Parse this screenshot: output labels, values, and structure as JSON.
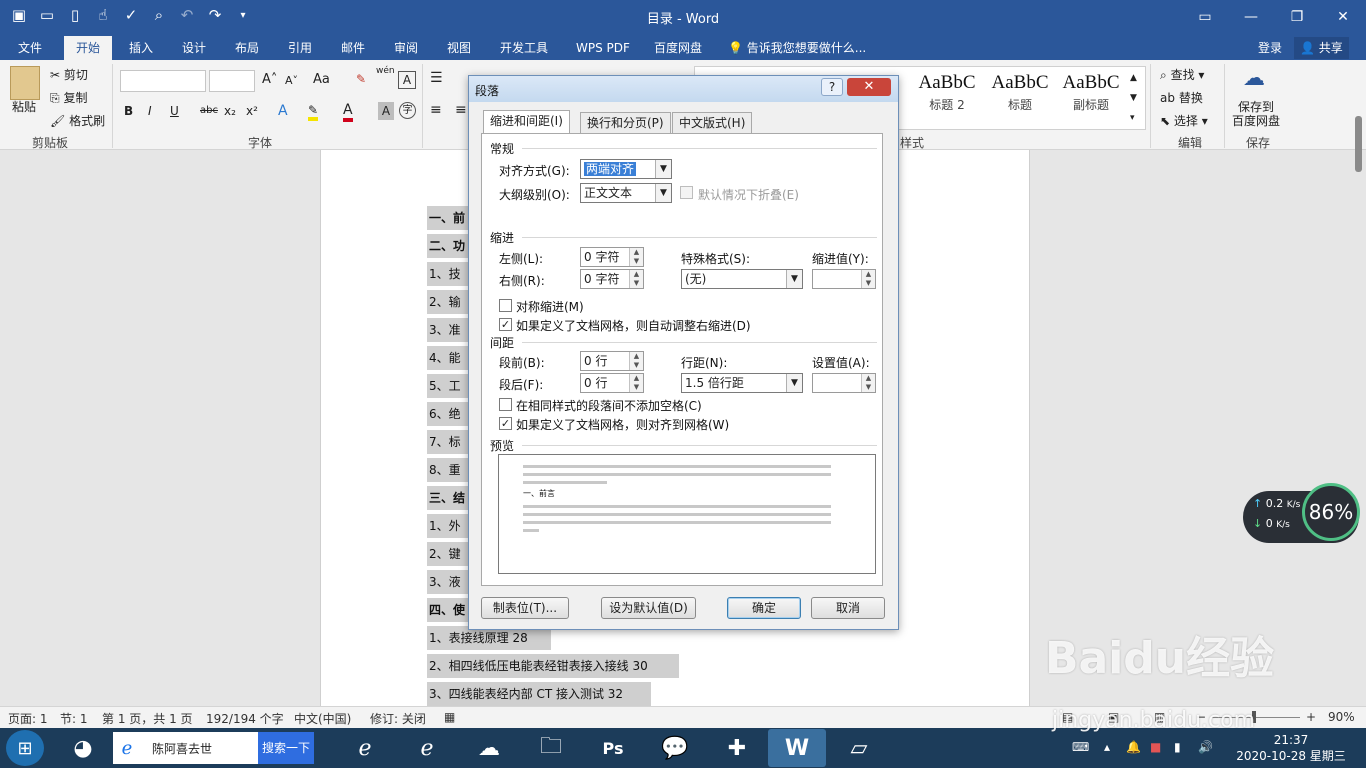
{
  "window": {
    "title": "目录 - Word"
  },
  "tabs": [
    "文件",
    "开始",
    "插入",
    "设计",
    "布局",
    "引用",
    "邮件",
    "审阅",
    "视图",
    "开发工具",
    "WPS PDF",
    "百度网盘"
  ],
  "tell_me": "告诉我您想要做什么...",
  "account": {
    "login": "登录",
    "share": "共享"
  },
  "ribbon": {
    "clipboard": {
      "paste": "粘贴",
      "cut": "剪切",
      "copy": "复制",
      "format_painter": "格式刷",
      "label": "剪贴板"
    },
    "font": {
      "label": "字体",
      "bold": "B",
      "italic": "I",
      "underline": "U",
      "strike": "abc",
      "sub": "x₂",
      "sup": "x²",
      "case": "Aa",
      "wen": "wén"
    },
    "styles": {
      "items": [
        {
          "sample": "AaBbC",
          "name": "标题 2"
        },
        {
          "sample": "AaBbC",
          "name": "标题"
        },
        {
          "sample": "AaBbC",
          "name": "副标题"
        }
      ],
      "label": "样式"
    },
    "editing": {
      "find": "查找",
      "replace": "替换",
      "select": "选择",
      "label": "编辑"
    },
    "save": {
      "line1": "保存到",
      "line2": "百度网盘",
      "label": "保存"
    }
  },
  "document": {
    "lines": [
      {
        "text": "一、前",
        "bold": true
      },
      {
        "text": "二、功",
        "bold": true
      },
      {
        "text": "1、技术",
        "bold": false
      },
      {
        "text": "2、输入",
        "bold": false
      },
      {
        "text": "3、准确",
        "bold": false
      },
      {
        "text": "4、能耗",
        "bold": false
      },
      {
        "text": "5、工作",
        "bold": false
      },
      {
        "text": "6、绝缘",
        "bold": false
      },
      {
        "text": "7、标准",
        "bold": false
      },
      {
        "text": "8、重量",
        "bold": false
      },
      {
        "text": "三、结",
        "bold": true
      },
      {
        "text": "1、外形",
        "bold": false
      },
      {
        "text": "2、键盘",
        "bold": false
      },
      {
        "text": "3、液晶",
        "bold": false
      },
      {
        "text": "四、使",
        "bold": true
      },
      {
        "text": "1、表接线原理    28",
        "bold": false
      },
      {
        "text": "2、相四线低压电能表经钳表接入接线    30",
        "bold": false
      },
      {
        "text": "3、四线能表经内部 CT 接入测试    32",
        "bold": false
      }
    ]
  },
  "dialog": {
    "title": "段落",
    "help": "?",
    "tabs": [
      "缩进和间距(I)",
      "换行和分页(P)",
      "中文版式(H)"
    ],
    "general": {
      "heading": "常规",
      "alignment_label": "对齐方式(G):",
      "alignment_value": "两端对齐",
      "outline_label": "大纲级别(O):",
      "outline_value": "正文文本",
      "collapse_label": "默认情况下折叠(E)"
    },
    "indent": {
      "heading": "缩进",
      "left_label": "左侧(L):",
      "left_value": "0 字符",
      "right_label": "右侧(R):",
      "right_value": "0 字符",
      "special_label": "特殊格式(S):",
      "special_value": "(无)",
      "by_label": "缩进值(Y):",
      "mirror_label": "对称缩进(M)",
      "auto_adjust_label": "如果定义了文档网格，则自动调整右缩进(D)"
    },
    "spacing": {
      "heading": "间距",
      "before_label": "段前(B):",
      "before_value": "0 行",
      "after_label": "段后(F):",
      "after_value": "0 行",
      "line_label": "行距(N):",
      "line_value": "1.5 倍行距",
      "at_label": "设置值(A):",
      "no_space_label": "在相同样式的段落间不添加空格(C)",
      "snap_grid_label": "如果定义了文档网格，则对齐到网格(W)"
    },
    "preview": {
      "heading": "预览",
      "sample_text": "一、前言"
    },
    "buttons": {
      "tabs": "制表位(T)...",
      "default": "设为默认值(D)",
      "ok": "确定",
      "cancel": "取消"
    }
  },
  "statusbar": {
    "page": "页面: 1",
    "section": "节: 1",
    "page_of": "第 1 页，共 1 页",
    "words": "192/194 个字",
    "language": "中文(中国)",
    "track": "修订: 关闭",
    "zoom": "90%"
  },
  "net_widget": {
    "up": "0.2",
    "down": "0",
    "unit": "K/s",
    "cpu": "86%"
  },
  "taskbar": {
    "search_text": "陈阿喜去世",
    "search_button": "搜索一下",
    "clock_time": "21:37",
    "clock_date": "2020-10-28 星期三"
  },
  "watermark": {
    "brand": "Baidu经验",
    "url": "jingyan.baidu.com"
  },
  "colors": {
    "accent": "#2b579a",
    "dialog_close": "#c9453a",
    "selection": "#3a7fd6"
  }
}
